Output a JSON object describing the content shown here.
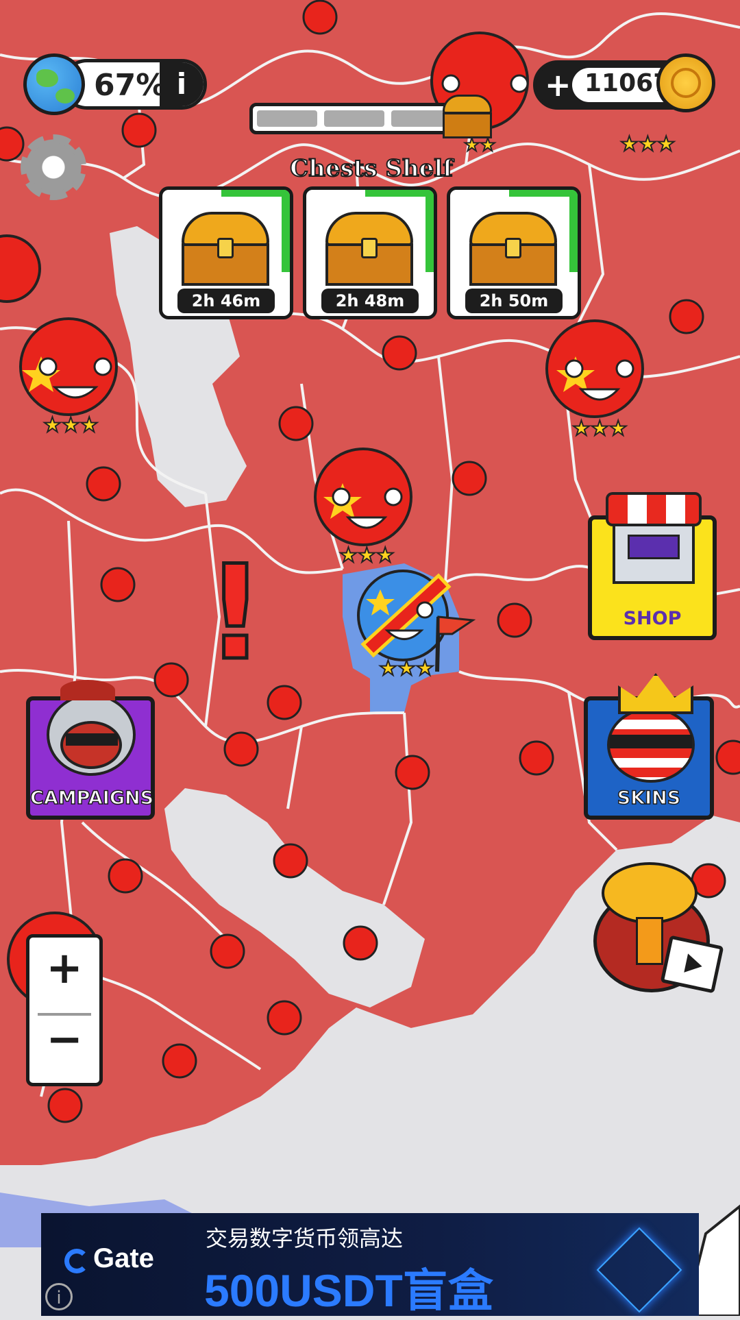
{
  "hud": {
    "world_percent": "67%",
    "info_label": "i",
    "coins": "110675",
    "plus_label": "+"
  },
  "chests_shelf": {
    "title": "Chests Shelf",
    "chests": [
      {
        "timer": "2h 46m"
      },
      {
        "timer": "2h 48m"
      },
      {
        "timer": "2h 50m"
      }
    ]
  },
  "buttons": {
    "shop": "SHOP",
    "campaigns": "CAMPAIGNS",
    "skins": "SKINS",
    "zoom_in": "+",
    "zoom_out": "−"
  },
  "alert_mark": "!",
  "ad": {
    "brand": "Gate",
    "line1": "交易数字货币领高达",
    "line2": "500USDT盲盒",
    "info": "i"
  },
  "colors": {
    "territory": "#d95552",
    "border": "#f3f3f3",
    "sea": "#e3e3e6",
    "player_territory": "#6f9ae6"
  },
  "icons": [
    "earth-icon",
    "info-icon",
    "coin-globe-icon",
    "settings-gear-icon",
    "chest-icon",
    "shop-stall-icon",
    "warrior-helmet-icon",
    "crowned-usa-ball-icon",
    "nuke-explosion-icon",
    "video-ad-icon",
    "plus-icon",
    "minus-icon",
    "exclamation-icon",
    "china-ball-icon",
    "congo-ball-icon",
    "flag-icon"
  ]
}
